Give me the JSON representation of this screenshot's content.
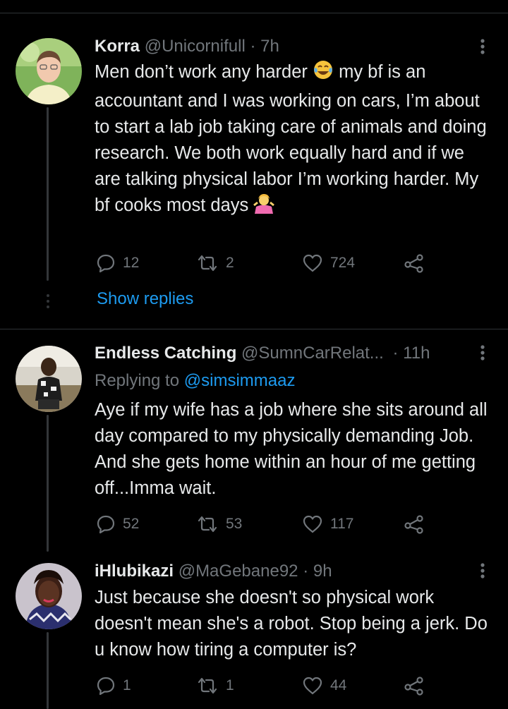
{
  "tweets": [
    {
      "name": "Korra",
      "handle": "@Unicornifull",
      "sep": "·",
      "time": "7h",
      "text_1": "Men don’t work any harder ",
      "text_2": " my bf is an accountant and I was working on cars, I’m about to start a lab job taking care of animals and doing research. We both work equally hard and if we are talking physical labor I’m working harder. My bf cooks most days ",
      "emoji_1": "face-with-tears-of-joy-icon",
      "emoji_2": "person-shrugging-icon",
      "replies": "12",
      "retweets": "2",
      "likes": "724"
    },
    {
      "name": "Endless Catching",
      "handle": "@SumnCarRelat...",
      "sep": "·",
      "time": "11h",
      "replying_prefix": "Replying to ",
      "replying_to": "@simsimmaaz",
      "text": "Aye if my wife has a job where she sits around all day compared to my physically demanding Job. And she gets home within an hour of me getting off...Imma wait.",
      "replies": "52",
      "retweets": "53",
      "likes": "117"
    },
    {
      "name": "iHlubikazi",
      "handle": "@MaGebane92",
      "sep": "·",
      "time": "9h",
      "text": "Just because she doesn't so physical work doesn't mean she's a robot. Stop being a jerk. Do u know how tiring a computer is?",
      "replies": "1",
      "retweets": "1",
      "likes": "44"
    }
  ],
  "show_replies": "Show replies",
  "colors": {
    "background": "#000000",
    "text": "#e7e9ea",
    "muted": "#71767b",
    "accent": "#1d9bf0",
    "divider": "#2f3336"
  }
}
